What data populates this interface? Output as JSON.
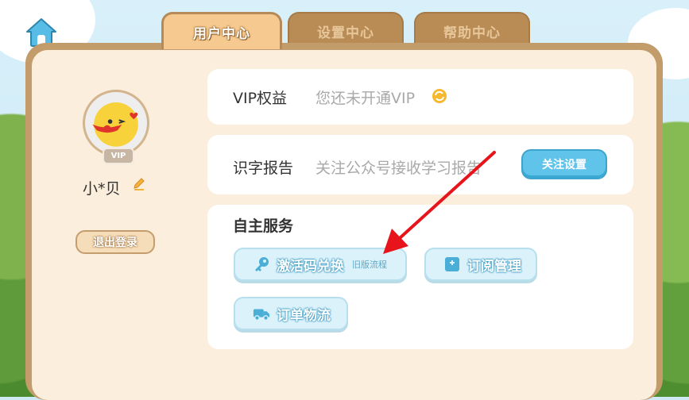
{
  "tabs": [
    {
      "label": "用户中心",
      "active": true
    },
    {
      "label": "设置中心",
      "active": false
    },
    {
      "label": "帮助中心",
      "active": false
    }
  ],
  "profile": {
    "vip_badge": "VIP",
    "username": "小*贝",
    "logout_label": "退出登录"
  },
  "vip_card": {
    "title": "VIP权益",
    "value": "您还未开通VIP"
  },
  "report_card": {
    "title": "识字报告",
    "value": "关注公众号接收学习报告",
    "button_label": "关注设置"
  },
  "services": {
    "title": "自主服务",
    "items": [
      {
        "label": "激活码兑换",
        "sub": "旧版流程",
        "icon": "key-icon"
      },
      {
        "label": "订阅管理",
        "sub": "",
        "icon": "bookmark-icon"
      },
      {
        "label": "订单物流",
        "sub": "",
        "icon": "truck-icon"
      }
    ]
  },
  "colors": {
    "accent_blue": "#5fc3ea",
    "panel_brown": "#c29c6b",
    "panel_bg": "#fbeedd",
    "annotation_red": "#e8141b"
  }
}
